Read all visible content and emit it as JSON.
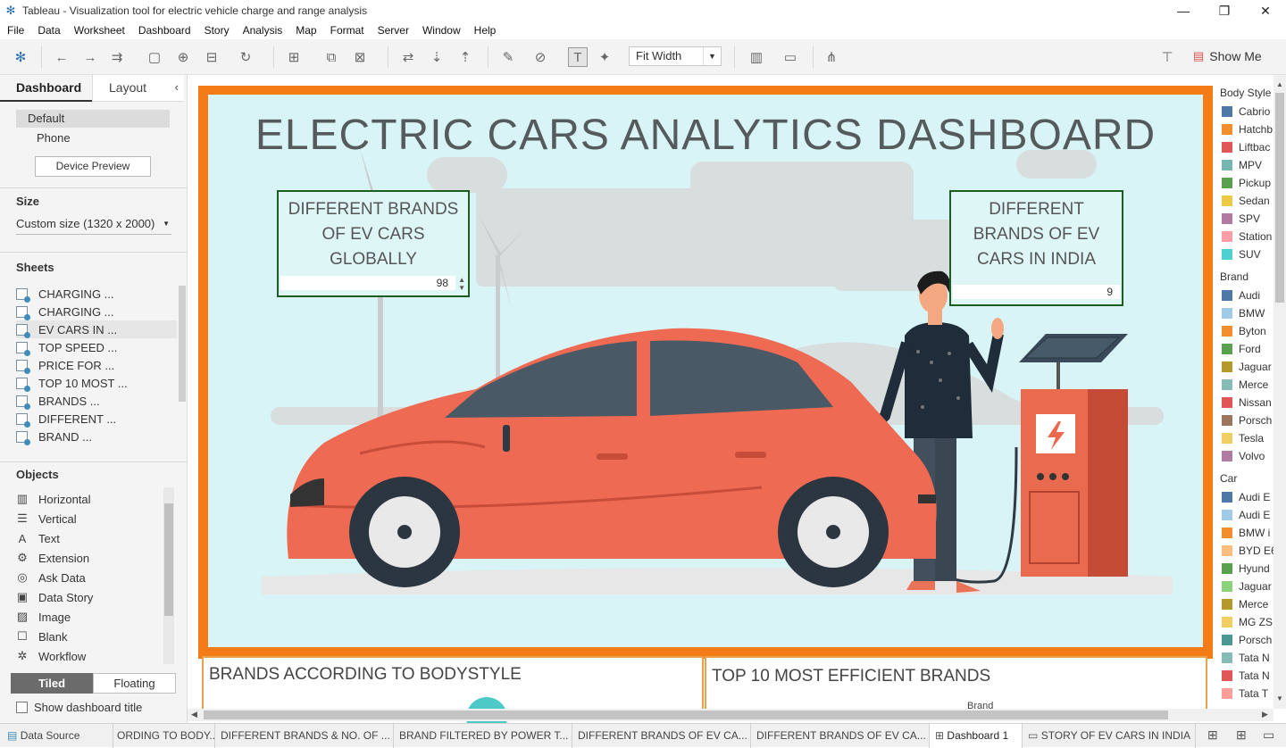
{
  "window": {
    "title": "Tableau - Visualization tool for electric vehicle charge and range analysis"
  },
  "menu": [
    "File",
    "Data",
    "Worksheet",
    "Dashboard",
    "Story",
    "Analysis",
    "Map",
    "Format",
    "Server",
    "Window",
    "Help"
  ],
  "toolbar": {
    "fit_value": "Fit Width",
    "show_me": "Show Me"
  },
  "left_panel": {
    "tabs": {
      "dashboard": "Dashboard",
      "layout": "Layout"
    },
    "device": {
      "default": "Default",
      "phone": "Phone",
      "preview_button": "Device Preview"
    },
    "size": {
      "heading": "Size",
      "value": "Custom size (1320 x 2000)"
    },
    "sheets_heading": "Sheets",
    "sheets": [
      "CHARGING ...",
      "CHARGING ...",
      "EV CARS IN ...",
      "TOP SPEED ...",
      "PRICE FOR ...",
      "TOP 10 MOST ...",
      "BRANDS ...",
      "DIFFERENT ...",
      "BRAND ..."
    ],
    "objects_heading": "Objects",
    "objects": [
      "Horizontal",
      "Vertical",
      "Text",
      "Extension",
      "Ask Data",
      "Data Story",
      "Image",
      "Blank",
      "Workflow"
    ],
    "tiled": "Tiled",
    "floating": "Floating",
    "show_title": "Show dashboard title"
  },
  "dashboard": {
    "title": "ELECTRIC CARS ANALYTICS DASHBOARD",
    "kpi_global": {
      "label": "DIFFERENT BRANDS OF EV CARS GLOBALLY",
      "value": "98"
    },
    "kpi_india": {
      "label": "DIFFERENT BRANDS OF EV CARS IN INDIA",
      "value": "9"
    },
    "panel_left_title": "BRANDS ACCORDING TO BODYSTYLE",
    "panel_right_title": "TOP 10 MOST EFFICIENT BRANDS",
    "panel_right_sub": "Brand"
  },
  "legend": {
    "body_style_heading": "Body Style",
    "body_style": [
      {
        "label": "Cabrio",
        "color": "#4e79a7"
      },
      {
        "label": "Hatchb",
        "color": "#f28e2b"
      },
      {
        "label": "Liftbac",
        "color": "#e15759"
      },
      {
        "label": "MPV",
        "color": "#76b7b2"
      },
      {
        "label": "Pickup",
        "color": "#59a14f"
      },
      {
        "label": "Sedan",
        "color": "#edc948"
      },
      {
        "label": "SPV",
        "color": "#b07aa1"
      },
      {
        "label": "Station",
        "color": "#ff9da7"
      },
      {
        "label": "SUV",
        "color": "#4dd0d2"
      }
    ],
    "brand_heading": "Brand",
    "brand": [
      {
        "label": "Audi",
        "color": "#4e79a7"
      },
      {
        "label": "BMW",
        "color": "#a0cbe8"
      },
      {
        "label": "Byton",
        "color": "#f28e2b"
      },
      {
        "label": "Ford",
        "color": "#59a14f"
      },
      {
        "label": "Jaguar",
        "color": "#b6992d"
      },
      {
        "label": "Merce",
        "color": "#86bcb6"
      },
      {
        "label": "Nissan",
        "color": "#e15759"
      },
      {
        "label": "Porsch",
        "color": "#9d7660"
      },
      {
        "label": "Tesla",
        "color": "#f1ce63"
      },
      {
        "label": "Volvo",
        "color": "#b07aa1"
      }
    ],
    "car_heading": "Car",
    "car": [
      {
        "label": "Audi E",
        "color": "#4e79a7"
      },
      {
        "label": "Audi E",
        "color": "#a0cbe8"
      },
      {
        "label": "BMW i",
        "color": "#f28e2b"
      },
      {
        "label": "BYD E6",
        "color": "#ffbe7d"
      },
      {
        "label": "Hyund",
        "color": "#59a14f"
      },
      {
        "label": "Jaguar",
        "color": "#8cd17d"
      },
      {
        "label": "Merce",
        "color": "#b6992d"
      },
      {
        "label": "MG ZS",
        "color": "#f1ce63"
      },
      {
        "label": "Porsch",
        "color": "#499894"
      },
      {
        "label": "Tata N",
        "color": "#86bcb6"
      },
      {
        "label": "Tata N",
        "color": "#e15759"
      },
      {
        "label": "Tata T",
        "color": "#ff9d9a"
      }
    ]
  },
  "tabs": {
    "data_source": "Data Source",
    "sheets": [
      "ORDING TO BODY...",
      "DIFFERENT BRANDS & NO. OF ...",
      "BRAND FILTERED BY POWER T...",
      "DIFFERENT BRANDS OF EV CA...",
      "DIFFERENT BRANDS OF EV CA..."
    ],
    "active": "Dashboard 1",
    "story": "STORY OF EV CARS IN INDIA"
  }
}
